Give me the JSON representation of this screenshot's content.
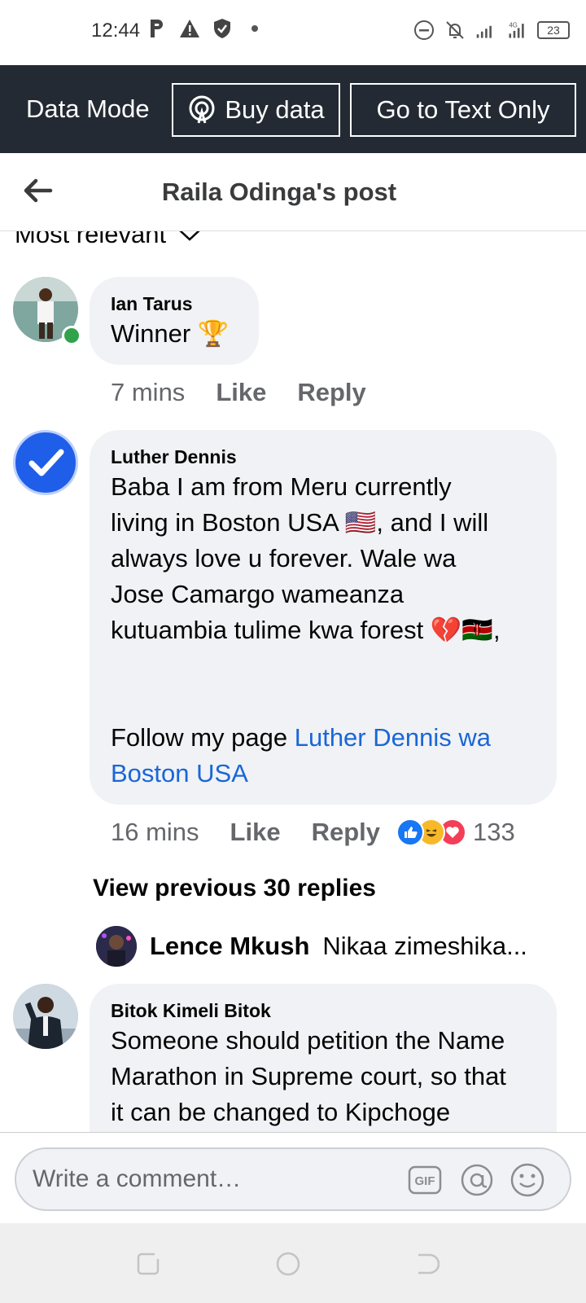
{
  "status_bar": {
    "time": "12:44",
    "battery": "23"
  },
  "data_bar": {
    "data_mode_label": "Data Mode",
    "buy_data_label": "Buy data",
    "text_only_label": "Go to Text Only"
  },
  "header": {
    "title": "Raila Odinga's post"
  },
  "sort": {
    "label": "Most relevant"
  },
  "comments": [
    {
      "author": "Ian Tarus",
      "text": "Winner 🏆",
      "time": "7 mins",
      "like": "Like",
      "reply": "Reply"
    },
    {
      "author": "Luther Dennis",
      "lines": [
        "Baba I am from Meru currently",
        "living in Boston USA 🇺🇸, and I will",
        "always love u forever. Wale wa",
        "Jose Camargo wameanza",
        "kutuambia tulime kwa forest 💔🇰🇪,"
      ],
      "follow_prefix": "Follow my page ",
      "follow_link_line1": "Luther Dennis wa",
      "follow_link_line2": "Boston USA",
      "time": "16 mins",
      "like": "Like",
      "reply": "Reply",
      "reaction_count": "133",
      "view_replies": "View previous 30 replies",
      "reply_preview": {
        "author": "Lence Mkush",
        "text": "Nikaa zimeshika..."
      }
    },
    {
      "author": "Bitok Kimeli Bitok",
      "lines": [
        "Someone should petition the Name",
        "Marathon in Supreme court, so that",
        "it can be changed to Kipchoge"
      ]
    }
  ],
  "composer": {
    "placeholder": "Write a comment…",
    "gif_label": "GIF"
  },
  "colors": {
    "data_bar_bg": "#242a33",
    "bubble_bg": "#f0f2f5",
    "link": "#1a66d6",
    "online": "#31a24c"
  }
}
